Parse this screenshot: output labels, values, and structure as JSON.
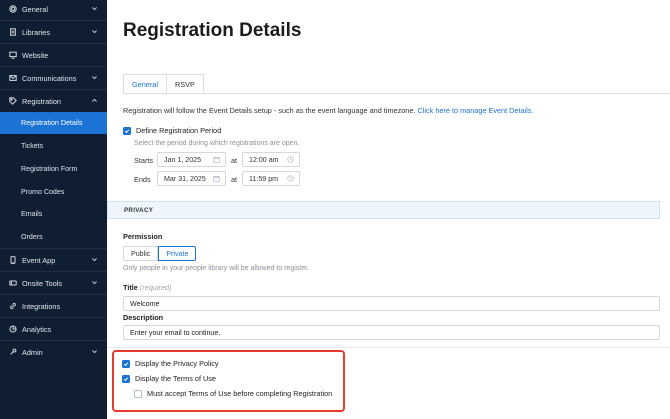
{
  "sidebar": {
    "items": [
      {
        "label": "General",
        "icon": "gear-icon",
        "chevron": "down"
      },
      {
        "label": "Libraries",
        "icon": "document-icon",
        "chevron": "down"
      },
      {
        "label": "Website",
        "icon": "monitor-icon",
        "chevron": ""
      },
      {
        "label": "Communications",
        "icon": "envelope-icon",
        "chevron": "down"
      },
      {
        "label": "Registration",
        "icon": "tag-icon",
        "chevron": "up"
      },
      {
        "label": "Event App",
        "icon": "phone-icon",
        "chevron": "down"
      },
      {
        "label": "Onsite Tools",
        "icon": "onsite-icon",
        "chevron": "down"
      },
      {
        "label": "Integrations",
        "icon": "link-icon",
        "chevron": ""
      },
      {
        "label": "Analytics",
        "icon": "pie-chart-icon",
        "chevron": ""
      },
      {
        "label": "Admin",
        "icon": "wrench-icon",
        "chevron": "down"
      }
    ],
    "registration_subitems": [
      {
        "label": "Registration Details",
        "active": true
      },
      {
        "label": "Tickets",
        "active": false
      },
      {
        "label": "Registration Form",
        "active": false
      },
      {
        "label": "Promo Codes",
        "active": false
      },
      {
        "label": "Emails",
        "active": false
      },
      {
        "label": "Orders",
        "active": false
      }
    ]
  },
  "main": {
    "title": "Registration Details",
    "tabs": [
      {
        "label": "General",
        "active": true
      },
      {
        "label": "RSVP",
        "active": false
      }
    ],
    "info_text": "Registration will follow the Event Details setup - such as the event language and timezone.",
    "info_link": "Click here to manage Event Details.",
    "define_period": {
      "label": "Define Registration Period",
      "checked": true,
      "hint": "Select the period during which registrations are open.",
      "starts_label": "Starts",
      "starts_date": "Jan 1, 2025",
      "starts_time": "12:00 am",
      "ends_label": "Ends",
      "ends_date": "Mar 31, 2025",
      "ends_time": "11:59 pm",
      "at_label": "at"
    },
    "privacy": {
      "section_title": "PRIVACY",
      "permission_label": "Permission",
      "options": [
        "Public",
        "Private"
      ],
      "selected": "Private",
      "permission_hint": "Only people in your people library will be allowed to register.",
      "title_label": "Title",
      "title_required": "(required)",
      "title_value": "Welcome",
      "description_label": "Description",
      "description_value": "Enter your email to continue.",
      "display_privacy_policy": {
        "label": "Display the Privacy Policy",
        "checked": true
      },
      "display_terms": {
        "label": "Display the Terms of Use",
        "checked": true
      },
      "must_accept": {
        "label": "Must accept Terms of Use before completing Registration",
        "checked": false
      }
    }
  },
  "colors": {
    "sidebar_bg": "#0f1e33",
    "accent": "#1b73d3",
    "highlight": "#e53b2f"
  }
}
